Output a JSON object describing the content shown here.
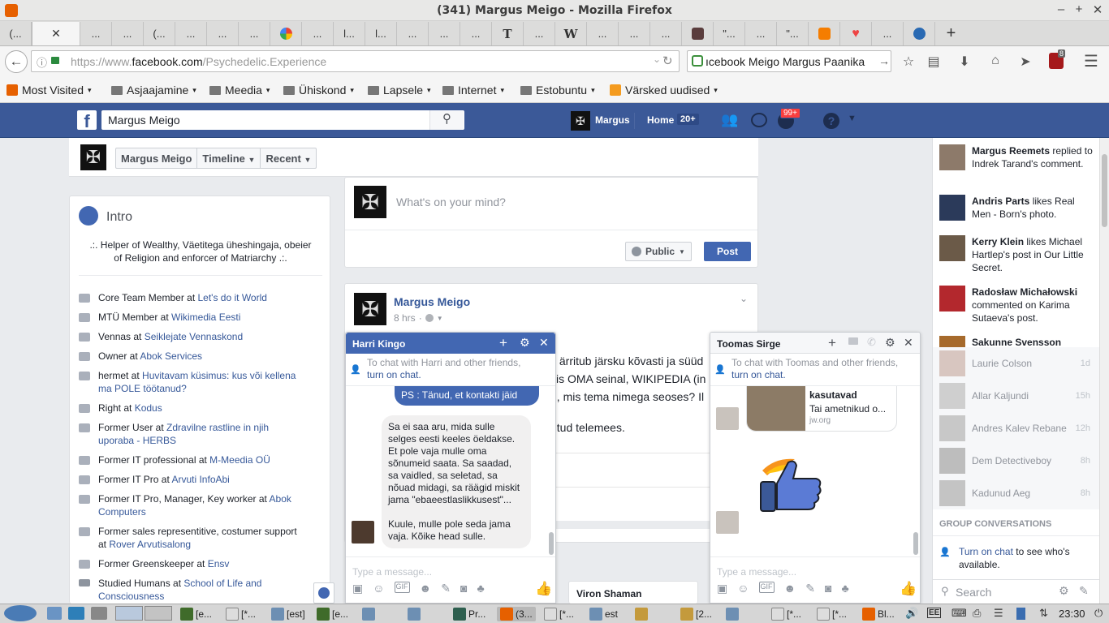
{
  "window": {
    "title": "(341) Margus Meigo - Mozilla Firefox"
  },
  "tabs": [
    "(...",
    "...",
    "...",
    "(...",
    "...",
    "...",
    "...",
    "...",
    "l...",
    "l...",
    "...",
    "...",
    "...",
    "...",
    "...",
    "...",
    "...",
    "...",
    "\"...",
    "...",
    "\"...",
    "...",
    "...",
    "..."
  ],
  "navbar": {
    "url_prefix": "https://www.",
    "url_domain": "facebook.com",
    "url_path": "/Psychedelic.Experience",
    "search_value": "ıcebook Meigo Margus  Paanika",
    "badge_count": "8"
  },
  "bookmarks": [
    "Most Visited",
    "Asjaajamine",
    "Meedia",
    "Ühiskond",
    "Lapsele",
    "Internet",
    "Estobuntu",
    "Värsked uudised"
  ],
  "fb": {
    "search_value": "Margus Meigo",
    "user_name": "Margus",
    "home_label": "Home",
    "home_count": "20+",
    "notif_count": "99+"
  },
  "profile_bar": {
    "name": "Margus Meigo",
    "timeline": "Timeline",
    "recent": "Recent"
  },
  "intro": {
    "title": "Intro",
    "bio": ".:. Helper of Wealthy, Väetitega üheshingaja, obeier of Religion and enforcer of Matriarchy .:.",
    "items": [
      {
        "text": "Core Team Member at ",
        "link": "Let's do it World"
      },
      {
        "text": "MTÜ Member at ",
        "link": "Wikimedia Eesti"
      },
      {
        "text": "Vennas at ",
        "link": "Seiklejate Vennaskond"
      },
      {
        "text": "Owner at ",
        "link": "Abok Services"
      },
      {
        "text": "hermet at ",
        "link": "Huvitavam küsimus: kus või kellena ma POLE töötanud?"
      },
      {
        "text": "Right at ",
        "link": "Kodus"
      },
      {
        "text": "Former User at ",
        "link": "Zdravilne rastline in njih uporaba - HERBS"
      },
      {
        "text": "Former IT professional at ",
        "link": "M-Meedia OÜ"
      },
      {
        "text": "Former IT Pro at ",
        "link": "Arvuti InfoAbi"
      },
      {
        "text": "Former IT Pro, Manager, Key worker at ",
        "link": "Abok Computers"
      },
      {
        "text": "Former sales representitive, costumer support at ",
        "link": "Rover Arvutisalong"
      },
      {
        "text": "Former Greenskeeper at ",
        "link": "Ensv"
      },
      {
        "text": "Studied Humans at ",
        "link": "School of Life and Consciousness"
      }
    ]
  },
  "composer": {
    "placeholder": "What's on your mind?",
    "audience": "Public",
    "post_button": "Post"
  },
  "post": {
    "author": "Margus Meigo",
    "time": "8 hrs",
    "line1": "s ärritub järsku kõvasti ja süüd",
    "line2": "kis OMA seinal, WIKIPEDIA (in",
    "line3": "d, mis tema nimega seoses? Il",
    "line4": "ntud telemees."
  },
  "chat_harri": {
    "name": "Harri Kingo",
    "notice_prefix": "To chat with Harri and other friends,",
    "notice_link": "turn on chat.",
    "sent": "PS : Tänud, et kontakti jäid",
    "received_1": "Sa ei saa aru, mida sulle selges eesti keeles öeldakse. Et pole vaja mulle oma sõnumeid saata. Sa saadad, sa vaidled, sa seletad, sa nõuad midagi, sa räägid miskit jama \"ebaeestlaslikkusest\"...",
    "received_2": "Kuule, mulle pole seda jama vaja. Kõike head sulle.",
    "input_placeholder": "Type a message..."
  },
  "chat_toomas": {
    "name": "Toomas Sirge",
    "notice_prefix": "To chat with Toomas and other friends,",
    "notice_link": "turn on chat.",
    "link_title": "kasutavad",
    "link_desc": "Tai ametnikud o...",
    "link_domain": "jw.org",
    "input_placeholder": "Type a message..."
  },
  "suggestion": {
    "name": "Viron Shaman"
  },
  "ticker": [
    {
      "name": "Margus Reemets",
      "text": " replied to Indrek Tarand's comment."
    },
    {
      "name": "Andris Parts",
      "text": " likes Real Men - Born's photo."
    },
    {
      "name": "Kerry Klein",
      "text": " likes Michael Hartlep's post in Our Little Secret."
    },
    {
      "name": "Radosław Michałowski",
      "text": " commented on Karima Sutaeva's post."
    },
    {
      "name": "Sakunne Svensson",
      "text": ""
    }
  ],
  "friends": [
    {
      "name": "Laurie Colson",
      "time": "1d"
    },
    {
      "name": "Allar Kaljundi",
      "time": "15h"
    },
    {
      "name": "Andres Kalev Rebane",
      "time": "12h"
    },
    {
      "name": "Dem Detectiveboy",
      "time": "8h"
    },
    {
      "name": "Kadunud Aeg",
      "time": "8h"
    }
  ],
  "group_header": "GROUP CONVERSATIONS",
  "turn_on": {
    "link": "Turn on chat",
    "text": " to see who's available."
  },
  "chat_search_placeholder": "Search",
  "taskbar": {
    "items": [
      "[e...",
      "[*...",
      "[est]",
      "[e...",
      "",
      "",
      "Pr...",
      "(3...",
      "[*...",
      "est",
      "",
      "[2...",
      "",
      "[*...",
      "[*...",
      "Bl..."
    ],
    "clock": "23:30"
  }
}
